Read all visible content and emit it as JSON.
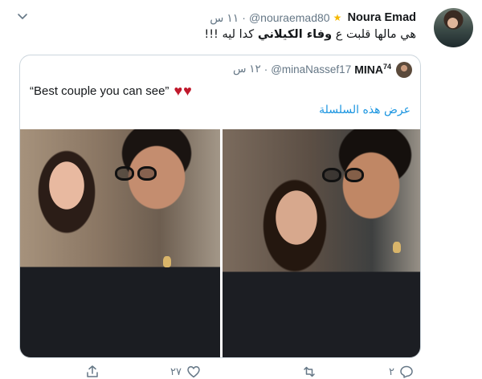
{
  "tweet": {
    "author_name": "Noura Emad",
    "author_handle": "@nouraemad80",
    "separator": "·",
    "time": "١١ س",
    "text_before": "هي مالها قلبت ع ",
    "text_bold": "وفاء الكيلاني",
    "text_after": " كدا ليه !!!"
  },
  "quote": {
    "author_name": "MINA",
    "author_sup": "74",
    "author_handle": "@minaNassef17",
    "separator": "·",
    "time": "١٢ س",
    "text": "“Best couple you can see”",
    "hearts": "♥♥",
    "show_thread": "عرض هذه السلسلة"
  },
  "actions": {
    "reply_count": "٢",
    "retweet_count": "",
    "like_count": "٢٧"
  },
  "colors": {
    "link": "#1b95e0",
    "muted": "#657786",
    "heart": "#c0192c",
    "border": "#ccd6dd"
  },
  "icons": [
    "chevron-down-icon",
    "star-emoji-icon",
    "reply-icon",
    "retweet-icon",
    "like-icon",
    "share-icon"
  ]
}
